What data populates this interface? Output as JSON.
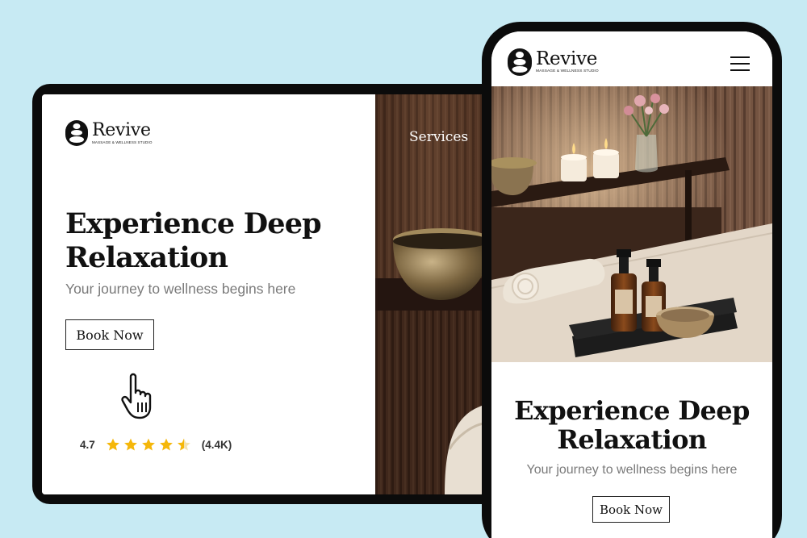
{
  "brand": {
    "name": "Revive",
    "tagline": "MASSAGE & WELLNESS STUDIO"
  },
  "tablet": {
    "nav_services": "Services",
    "hero_title": "Experience Deep Relaxation",
    "hero_subtitle": "Your journey to wellness begins here",
    "cta_label": "Book Now",
    "rating": {
      "value": "4.7",
      "count": "(4.4K)",
      "stars_filled": 4.5,
      "stars_total": 5
    }
  },
  "phone": {
    "hero_title": "Experience Deep Relaxation",
    "hero_subtitle": "Your journey to wellness begins here",
    "cta_label": "Book Now",
    "menu_icon": "hamburger-icon"
  },
  "colors": {
    "background": "#c7eaf3",
    "device_frame": "#0b0b0b",
    "star": "#f5b70a",
    "subtitle_gray": "#7a7a7a"
  }
}
